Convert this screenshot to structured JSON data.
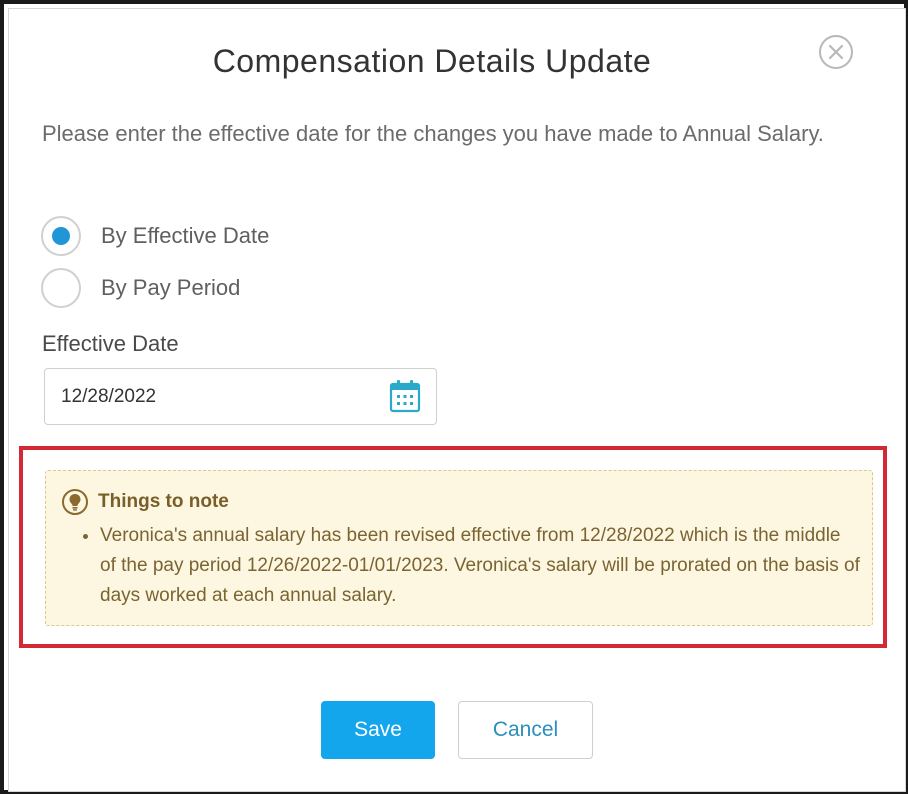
{
  "dialog": {
    "title": "Compensation Details Update",
    "intro": "Please enter the effective date for the changes you have made to Annual Salary."
  },
  "options": [
    {
      "label": "By Effective Date",
      "checked": true
    },
    {
      "label": "By Pay Period",
      "checked": false
    }
  ],
  "effective_date": {
    "label": "Effective Date",
    "value": "12/28/2022"
  },
  "note": {
    "title": "Things to note",
    "items": [
      "Veronica's annual salary has been revised effective from 12/28/2022 which is the middle of the pay period 12/26/2022-01/01/2023. Veronica's salary will be prorated on the basis of days worked at each annual salary."
    ]
  },
  "buttons": {
    "save": "Save",
    "cancel": "Cancel"
  },
  "icons": {
    "close": "close-icon",
    "calendar": "calendar-icon",
    "note": "lightbulb-icon"
  },
  "colors": {
    "accent": "#14a6ec",
    "radio_selected": "#2196d6",
    "note_bg": "#fdf7e1",
    "highlight_border": "#d12a35",
    "calendar": "#2aa9c9"
  }
}
